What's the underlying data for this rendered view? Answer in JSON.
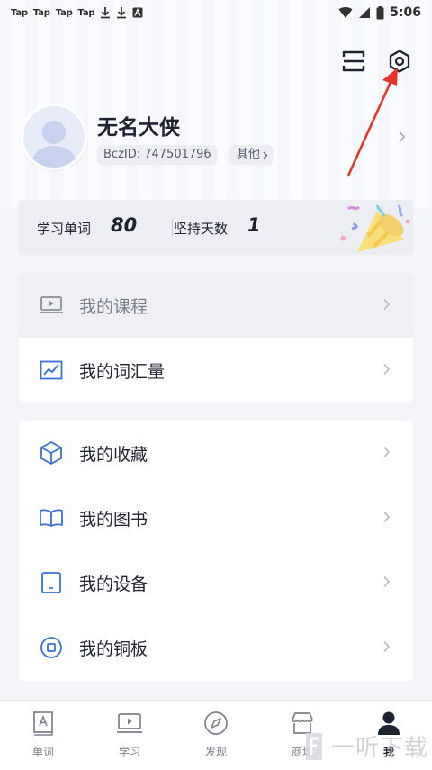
{
  "status_bar": {
    "tap_items": [
      "Tap",
      "Tap",
      "Tap",
      "Tap"
    ],
    "time": "5:06"
  },
  "header": {
    "scan_icon": "scan-icon",
    "settings_icon": "settings-hexagon-icon"
  },
  "profile": {
    "name": "无名大侠",
    "bcz_id": "BczID: 747501796",
    "other_label": "其他"
  },
  "stats": {
    "words_label": "学习单词",
    "words_value": "80",
    "days_label": "坚持天数",
    "days_value": "1"
  },
  "menu_group1": [
    {
      "label": "我的课程",
      "icon": "course-screen-icon"
    },
    {
      "label": "我的词汇量",
      "icon": "trend-chart-icon"
    }
  ],
  "menu_group2": [
    {
      "label": "我的收藏",
      "icon": "cube-icon"
    },
    {
      "label": "我的图书",
      "icon": "book-icon"
    },
    {
      "label": "我的设备",
      "icon": "device-icon"
    },
    {
      "label": "我的铜板",
      "icon": "coin-icon"
    }
  ],
  "bottom_nav": [
    {
      "label": "单词",
      "icon": "word-card-icon"
    },
    {
      "label": "学习",
      "icon": "study-screen-icon"
    },
    {
      "label": "发现",
      "icon": "compass-icon"
    },
    {
      "label": "商城",
      "icon": "store-icon"
    },
    {
      "label": "我",
      "icon": "person-icon",
      "active": true
    }
  ],
  "watermark": "一听下载",
  "colors": {
    "icon_blue": "#3b6fd8",
    "text_dark": "#1f2230",
    "arrow_red": "#e5352b",
    "background": "#f4f5f9"
  }
}
